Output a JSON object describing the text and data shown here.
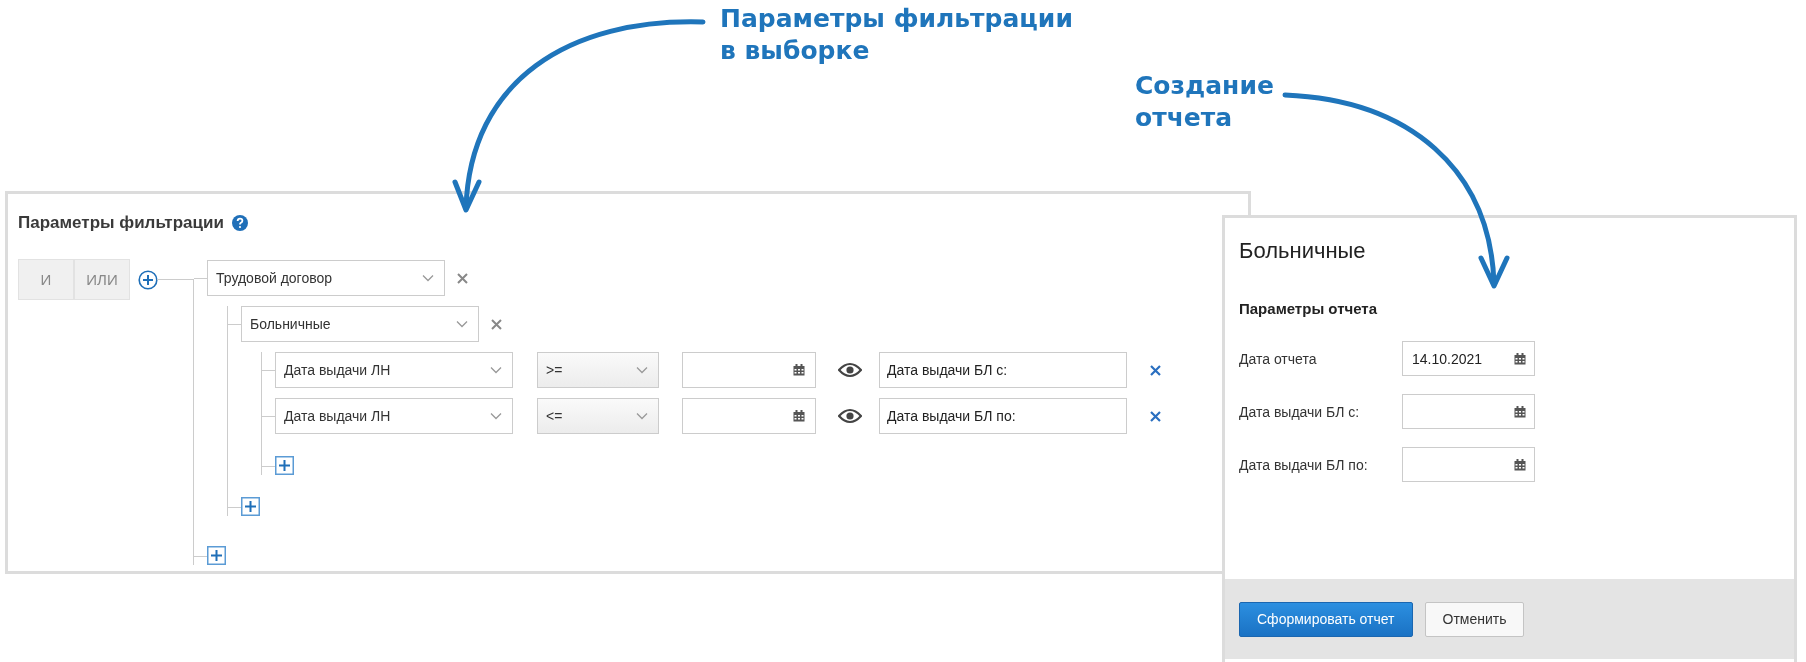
{
  "annotations": [
    {
      "lines": [
        "Параметры фильтрации",
        "в выборке"
      ]
    },
    {
      "lines": [
        "Создание",
        "отчета"
      ]
    }
  ],
  "filter_panel": {
    "title": "Параметры фильтрации",
    "logic": [
      {
        "label": "И",
        "selected": false
      },
      {
        "label": "ИЛИ",
        "selected": false
      }
    ],
    "tree": [
      {
        "kind": "group",
        "value": "Трудовой договор",
        "children": [
          {
            "kind": "group",
            "value": "Больничные",
            "children": [
              {
                "kind": "condition",
                "field": "Дата выдачи ЛН",
                "operator": ">=",
                "caption": "Дата выдачи БЛ с:"
              },
              {
                "kind": "condition",
                "field": "Дата выдачи ЛН",
                "operator": "<=",
                "caption": "Дата выдачи БЛ по:"
              }
            ]
          }
        ]
      }
    ]
  },
  "report_panel": {
    "title": "Больничные",
    "section": "Параметры отчета",
    "fields": [
      {
        "label": "Дата отчета",
        "value": "14.10.2021"
      },
      {
        "label": "Дата выдачи БЛ с:"
      },
      {
        "label": "Дата выдачи БЛ по:"
      }
    ],
    "buttons": [
      {
        "label": "Сформировать отчет",
        "kind": "primary"
      },
      {
        "label": "Отменить",
        "kind": "secondary"
      }
    ]
  }
}
